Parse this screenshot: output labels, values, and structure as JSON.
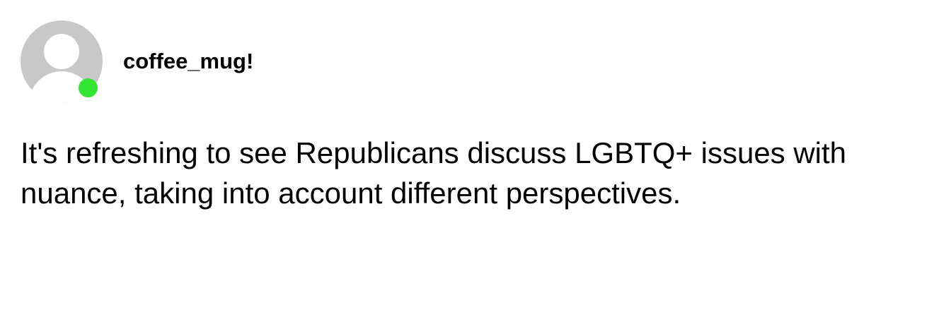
{
  "post": {
    "author": {
      "username": "coffee_mug!",
      "avatar_icon": "default-user-avatar-icon",
      "online": true
    },
    "text": "It's refreshing to see Republicans discuss LGBTQ+ issues with nuance, taking into account different perspectives."
  },
  "colors": {
    "background": "#ffffff",
    "avatar_fill": "#c8c8c8",
    "avatar_silhouette": "#ffffff",
    "online_indicator": "#33e533",
    "text": "#000000"
  }
}
